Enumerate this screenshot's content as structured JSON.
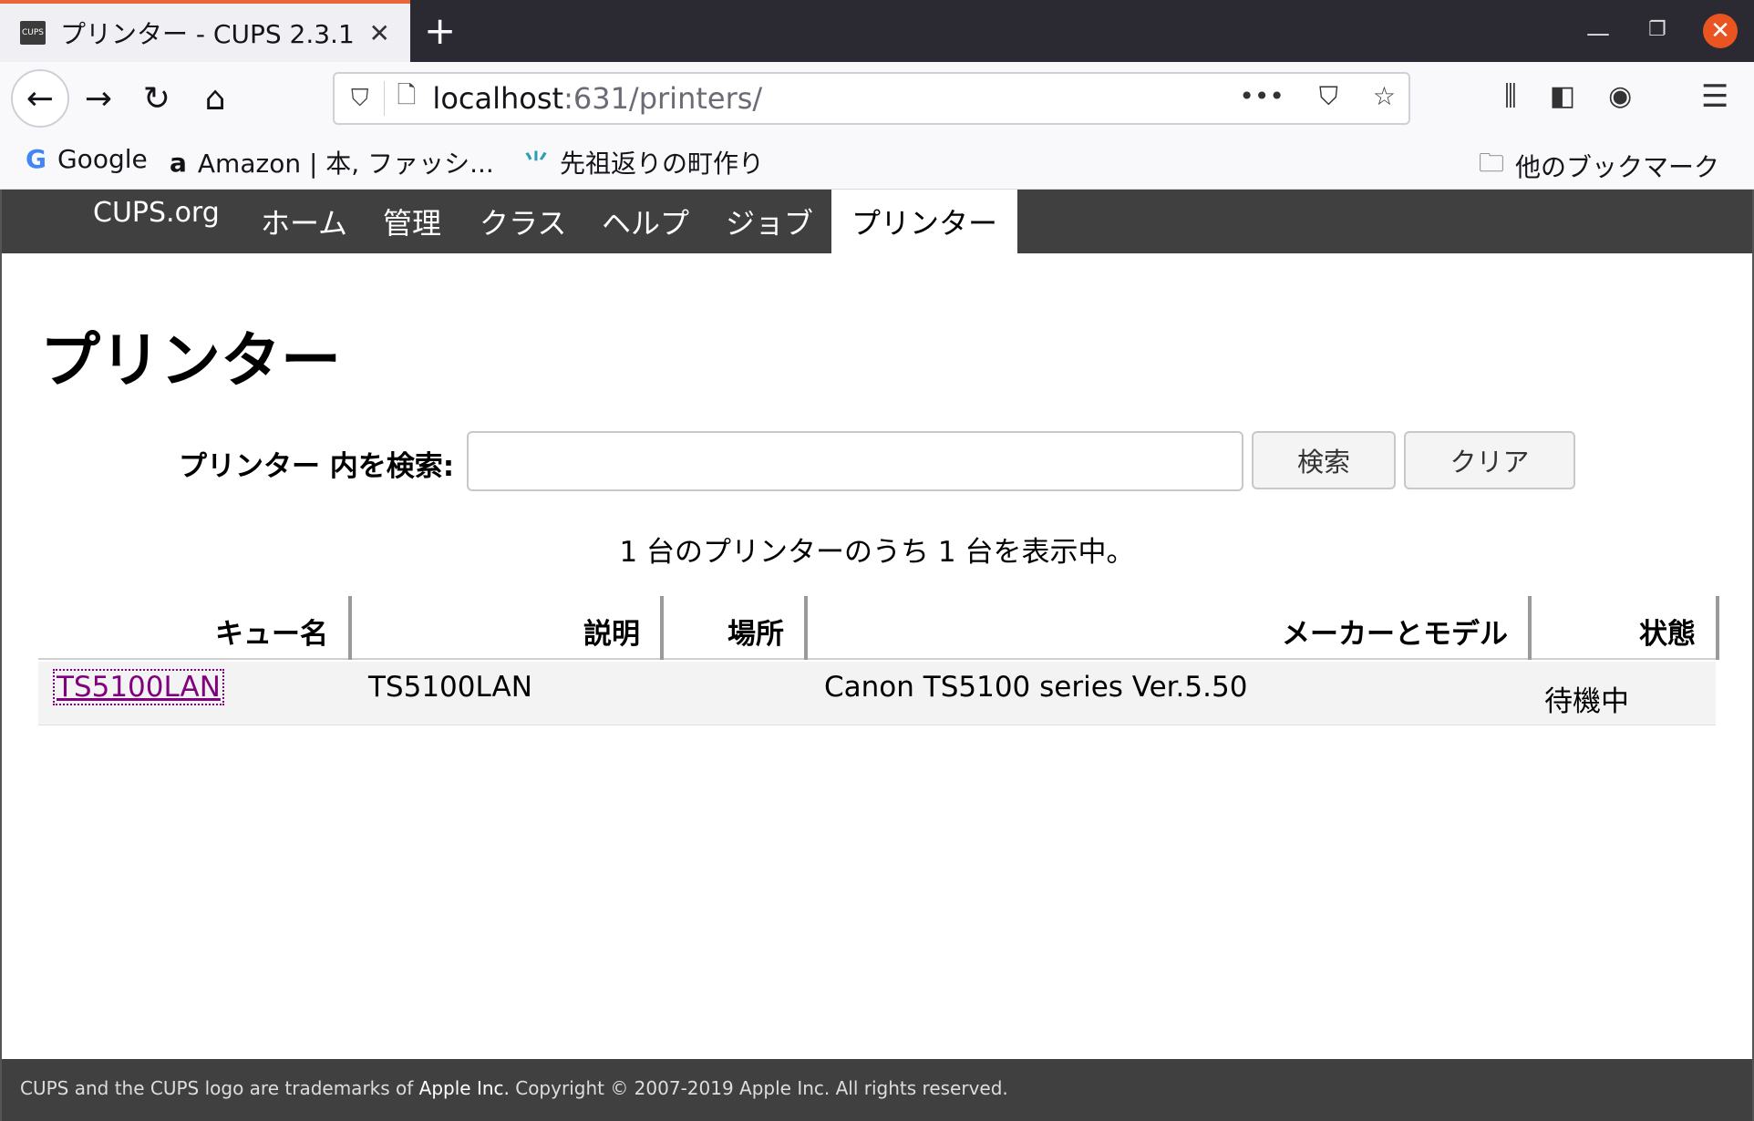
{
  "browser": {
    "tab_title": "プリンター - CUPS 2.3.1",
    "favicon_text": "CUPS",
    "url_host": "localhost",
    "url_path": ":631/printers/",
    "bookmarks": [
      {
        "icon": "G",
        "label": "Google"
      },
      {
        "icon": "a",
        "label": "Amazon | 本, ファッシ..."
      },
      {
        "icon": "⺌",
        "label": "先祖返りの町作り"
      }
    ],
    "other_bookmarks": "他のブックマーク"
  },
  "cups_nav": {
    "logo": "CUPS.org",
    "tabs": [
      "ホーム",
      "管理",
      "クラス",
      "ヘルプ",
      "ジョブ",
      "プリンター"
    ]
  },
  "page": {
    "title": "プリンター",
    "search_label": "プリンター 内を検索:",
    "search_value": "",
    "search_button": "検索",
    "clear_button": "クリア",
    "showing_text": "1 台のプリンターのうち 1 台を表示中。"
  },
  "table": {
    "headers": [
      "キュー名",
      "説明",
      "場所",
      "メーカーとモデル",
      "状態"
    ],
    "rows": [
      {
        "queue": "TS5100LAN",
        "description": "TS5100LAN",
        "location": "",
        "make_model": "Canon TS5100 series Ver.5.50",
        "state": "待機中"
      }
    ]
  },
  "footer": {
    "prefix": "CUPS and the CUPS logo are trademarks of ",
    "apple": "Apple Inc.",
    "suffix": " Copyright © 2007-2019 Apple Inc. All rights reserved."
  }
}
